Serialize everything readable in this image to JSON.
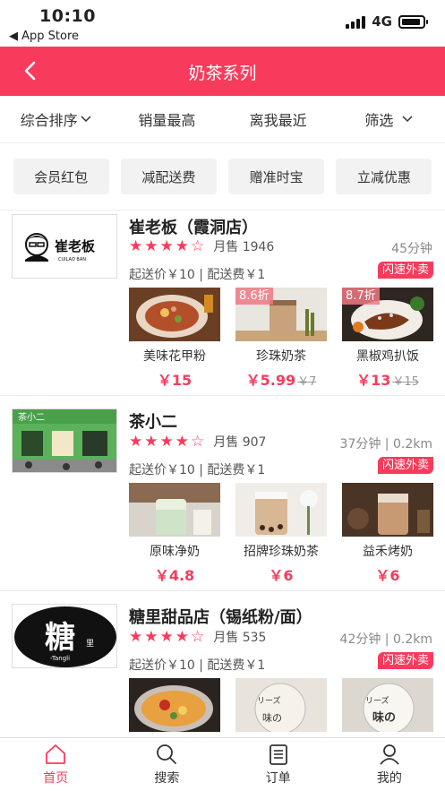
{
  "status": {
    "time": "10:10",
    "back_app": "◀ App Store",
    "network": "4G"
  },
  "header": {
    "title": "奶茶系列"
  },
  "sort": [
    "综合排序",
    "销量最高",
    "离我最近",
    "筛选"
  ],
  "chips": [
    "会员红包",
    "减配送费",
    "赠准时宝",
    "立减优惠"
  ],
  "shops": [
    {
      "name": "崔老板（霞洞店）",
      "logo_text": "崔老板",
      "logo_sub": "CUILAO BAN",
      "rating": 4,
      "sold": "月售 1946",
      "distance": "45分钟",
      "fees": "起送价￥10 | 配送费￥1",
      "badge": "闪速外卖",
      "dishes": [
        {
          "name": "美味花甲粉",
          "price": "￥15",
          "old": "",
          "discount": ""
        },
        {
          "name": "珍珠奶茶",
          "price": "￥5.99",
          "old": "￥7",
          "discount": "8.6折"
        },
        {
          "name": "黑椒鸡扒饭",
          "price": "￥13",
          "old": "￥15",
          "discount": "8.7折"
        }
      ]
    },
    {
      "name": "茶小二",
      "logo_text": "茶小二",
      "logo_sub": "",
      "rating": 4,
      "sold": "月售 907",
      "distance": "37分钟 | 0.2km",
      "fees": "起送价￥10 | 配送费￥1",
      "badge": "闪速外卖",
      "dishes": [
        {
          "name": "原味净奶",
          "price": "￥4.8",
          "old": "",
          "discount": ""
        },
        {
          "name": "招牌珍珠奶茶",
          "price": "￥6",
          "old": "",
          "discount": ""
        },
        {
          "name": "益禾烤奶",
          "price": "￥6",
          "old": "",
          "discount": ""
        }
      ]
    },
    {
      "name": "糖里甜品店（锡纸粉/面）",
      "logo_text": "糖",
      "logo_sub": "-Tangli",
      "logo_small": "里",
      "rating": 4,
      "sold": "月售 535",
      "distance": "42分钟 | 0.2km",
      "fees": "起送价￥10 | 配送费￥1",
      "badge": "闪速外卖",
      "dishes": [
        {
          "name": "",
          "price": "",
          "old": "",
          "discount": ""
        },
        {
          "name": "",
          "price": "",
          "old": "",
          "discount": ""
        },
        {
          "name": "",
          "price": "",
          "old": "",
          "discount": ""
        }
      ]
    }
  ],
  "tabs": [
    {
      "label": "首页",
      "icon": "home-icon",
      "active": true
    },
    {
      "label": "搜索",
      "icon": "search-icon",
      "active": false
    },
    {
      "label": "订单",
      "icon": "orders-icon",
      "active": false
    },
    {
      "label": "我的",
      "icon": "user-icon",
      "active": false
    }
  ],
  "colors": {
    "accent": "#f83b5c"
  }
}
